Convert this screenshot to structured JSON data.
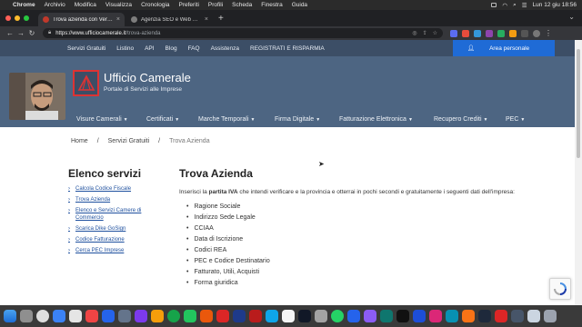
{
  "menubar": {
    "app": "Chrome",
    "items": [
      "Archivio",
      "Modifica",
      "Visualizza",
      "Cronologia",
      "Preferiti",
      "Profili",
      "Scheda",
      "Finestra",
      "Guida"
    ],
    "clock": "Lun 12 giu  18:56"
  },
  "tabs": [
    {
      "title": "Trova azienda con Verifica Parti",
      "active": true,
      "favicon_color": "#c0392b"
    },
    {
      "title": "Agenzia SEO e Web Marketing",
      "active": false,
      "favicon_color": "#7d7d7d"
    }
  ],
  "address": {
    "host": "https://www.ufficiocamerale.it",
    "path": "/trova-azienda"
  },
  "site": {
    "topnav": [
      "Servizi Gratuiti",
      "Listino",
      "API",
      "Blog",
      "FAQ",
      "Assistenza",
      "REGISTRATI E RISPARMIA"
    ],
    "area_button": "Area personale",
    "brand": "Ufficio Camerale",
    "tagline": "Portale di Servizi alle Imprese",
    "mainnav": [
      "Visure Camerali",
      "Certificati",
      "Marche Temporali",
      "Firma Digitale",
      "Fatturazione Elettronica",
      "Recupero Crediti",
      "PEC"
    ],
    "breadcrumb": {
      "home": "Home",
      "sep": "/",
      "mid": "Servizi Gratuiti",
      "current": "Trova Azienda"
    },
    "sidebar": {
      "title": "Elenco servizi",
      "items": [
        "Calcola Codice Fiscale",
        "Trova Azienda",
        "Elenco e Servizi Camere di Commercio",
        "Scarica Dike GoSign",
        "Codice Fatturazione",
        "Cerca PEC Imprese"
      ]
    },
    "content": {
      "title": "Trova Azienda",
      "intro_pre": "Inserisci la ",
      "intro_bold": "partita IVA",
      "intro_post": " che intendi verificare e la provincia e otterrai in pochi secondi e gratuitamente i seguenti dati dell'impresa:",
      "list": [
        "Ragione Sociale",
        "Indirizzo Sede Legale",
        "CCIAA",
        "Data di Iscrizione",
        "Codici REA",
        "PEC e Codice Destinatario",
        "Fatturato, Utili, Acquisti",
        "Forma giuridica"
      ]
    }
  },
  "colors": {
    "header_dark": "#3c4e66",
    "header_hero": "#4d6582",
    "accent_blue": "#1f6bd6",
    "link": "#1d4f9e"
  }
}
